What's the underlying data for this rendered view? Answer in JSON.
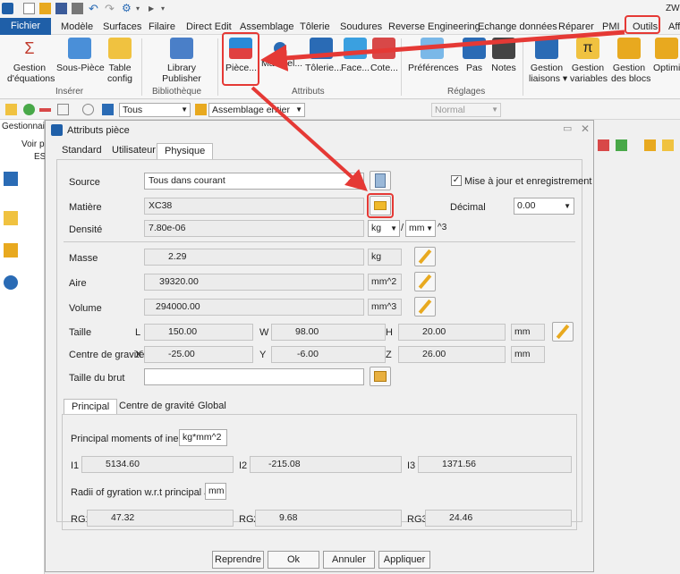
{
  "app": {
    "title_fragment": "ZW"
  },
  "menubar": {
    "fichier": "Fichier",
    "items": [
      "Modèle",
      "Surfaces",
      "Filaire",
      "Direct Edit",
      "Assemblage",
      "Tôlerie",
      "Soudures",
      "Reverse Engineering",
      "Echange données",
      "Réparer",
      "PMI",
      "Outils",
      "Affi"
    ]
  },
  "ribbon": {
    "buttons": {
      "gestion_equations": "Gestion\nd'équations",
      "sous_piece": "Sous-Pièce",
      "table_config": "Table\nconfig",
      "library_publisher": "Library\nPublisher",
      "piece": "Pièce...",
      "materiel": "Matériel...",
      "tolerie": "Tôlerie...",
      "face": "Face...",
      "cote": "Cote...",
      "preferences": "Préférences",
      "pas": "Pas",
      "notes": "Notes",
      "gestion_liaisons": "Gestion\nliaisons ▾",
      "gestion_variables": "Gestion\nvariables",
      "gestion_blocs": "Gestion\ndes blocs",
      "optim": "Optimi"
    },
    "groups": {
      "inserer": "Insérer",
      "bibliotheque": "Bibliothèque",
      "attributs": "Attributs",
      "reglages": "Réglages"
    }
  },
  "toolbar2": {
    "filter": "Tous",
    "scope": "Assemblage entier",
    "style": "Normal"
  },
  "leftpanel": {
    "header": "Gestionnai",
    "voir": "Voir p",
    "es": "ES"
  },
  "dialog": {
    "title": "Attributs pièce",
    "tabs": [
      "Standard",
      "Utilisateur",
      "Physique"
    ],
    "source": {
      "label": "Source",
      "value": "Tous dans courant"
    },
    "maj": {
      "label": "Mise à jour et enregistrement",
      "checked": true
    },
    "matiere": {
      "label": "Matière",
      "value": "XC38"
    },
    "decimal": {
      "label": "Décimal",
      "value": "0.00"
    },
    "densite": {
      "label": "Densité",
      "value": "7.80e-06",
      "unit1": "kg",
      "unit2": "mm",
      "exp": "^3",
      "slash": "/"
    },
    "masse": {
      "label": "Masse",
      "value": "2.29",
      "unit": "kg"
    },
    "aire": {
      "label": "Aire",
      "value": "39320.00",
      "unit": "mm^2"
    },
    "volume": {
      "label": "Volume",
      "value": "294000.00",
      "unit": "mm^3"
    },
    "taille": {
      "label": "Taille",
      "l_label": "L",
      "l": "150.00",
      "w_label": "W",
      "w": "98.00",
      "h_label": "H",
      "h": "20.00",
      "unit": "mm"
    },
    "cg": {
      "label": "Centre de gravité",
      "x_label": "X",
      "x": "-25.00",
      "y_label": "Y",
      "y": "-6.00",
      "z_label": "Z",
      "z": "26.00",
      "unit": "mm"
    },
    "brut": {
      "label": "Taille du brut",
      "value": ""
    },
    "subtabs": [
      "Principal",
      "Centre de gravité",
      "Global"
    ],
    "pmi": {
      "label": "Principal moments of inertia",
      "unit": "kg*mm^2",
      "i1_label": "I1",
      "i1": "5134.60",
      "i2_label": "I2",
      "i2": "-215.08",
      "i3_label": "I3",
      "i3": "1371.56"
    },
    "rg": {
      "label": "Radii of gyration w.r.t principal axes",
      "unit": "mm",
      "rg1_label": "RG1",
      "rg1": "47.32",
      "rg2_label": "RG2",
      "rg2": "9.68",
      "rg3_label": "RG3",
      "rg3": "24.46"
    },
    "buttons": {
      "reprendre": "Reprendre",
      "ok": "Ok",
      "annuler": "Annuler",
      "appliquer": "Appliquer"
    }
  },
  "colors": {
    "accent": "#1f5fa8",
    "highlight": "#e53935"
  }
}
